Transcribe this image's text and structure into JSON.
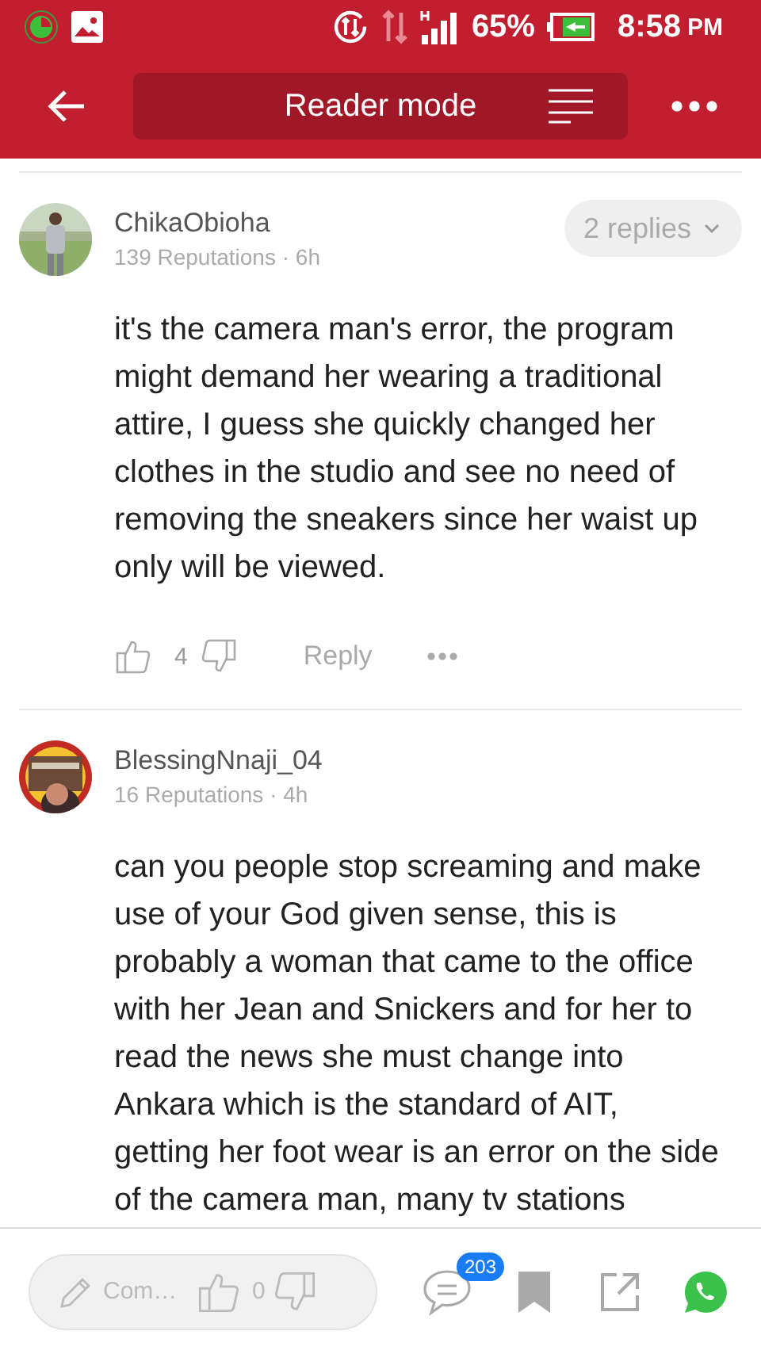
{
  "status_bar": {
    "battery": "65%",
    "time": "8:58",
    "ampm": "PM"
  },
  "toolbar": {
    "title": "Reader mode"
  },
  "comments": [
    {
      "author": "ChikaObioha",
      "meta": "139 Reputations · 6h",
      "replies": "2 replies",
      "text": "it's the camera man's error, the program might demand her wearing a traditional attire, I guess she quickly changed her clothes in the studio and see no need of removing the sneakers since her waist up only will be viewed.",
      "likes": "4",
      "reply_label": "Reply"
    },
    {
      "author": "BlessingNnaji_04",
      "meta": "16 Reputations · 4h",
      "text": "can you people stop screaming and make use of your God given sense, this is probably a woman that came to the office with her Jean and Snickers and for her to read the news she must change into Ankara which is the standard of AIT, getting her foot wear is an error on the side of the camera man, many tv stations"
    }
  ],
  "bottom_bar": {
    "placeholder": "Com…",
    "likes": "0",
    "comment_count": "203"
  }
}
